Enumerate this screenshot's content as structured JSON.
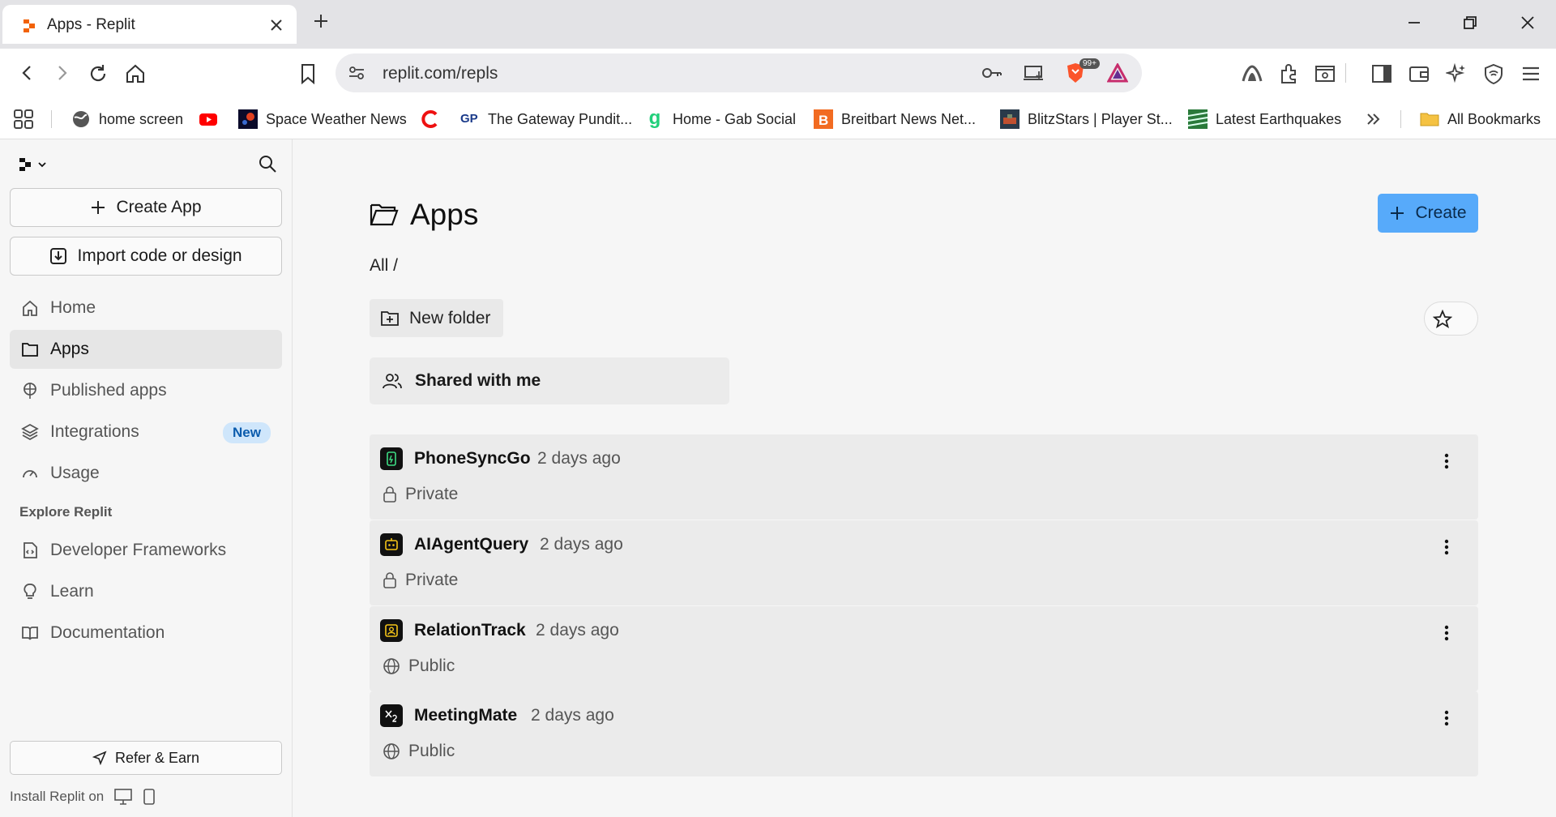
{
  "browser": {
    "tab_title": "Apps - Replit",
    "url": "replit.com/repls",
    "brave_badge": "99+",
    "bookmarks": [
      {
        "label": "home screen",
        "icon": "globe-icon"
      },
      {
        "label": "",
        "icon": "youtube-icon"
      },
      {
        "label": "Space Weather News",
        "icon": "space-weather-icon"
      },
      {
        "label": "",
        "icon": "red-c-icon"
      },
      {
        "label": "The Gateway Pundit...",
        "icon": "gp-icon"
      },
      {
        "label": "Home - Gab Social",
        "icon": "gab-icon"
      },
      {
        "label": "Breitbart News Net...",
        "icon": "breitbart-icon"
      },
      {
        "label": "BlitzStars | Player St...",
        "icon": "blitzstars-icon"
      },
      {
        "label": "Latest Earthquakes",
        "icon": "earthquake-icon"
      }
    ],
    "all_bookmarks": "All Bookmarks"
  },
  "sidebar": {
    "create_app": "Create App",
    "import": "Import code or design",
    "nav": [
      {
        "label": "Home",
        "icon": "home-icon"
      },
      {
        "label": "Apps",
        "icon": "folder-icon"
      },
      {
        "label": "Published apps",
        "icon": "published-icon"
      },
      {
        "label": "Integrations",
        "icon": "layers-icon",
        "badge": "New"
      },
      {
        "label": "Usage",
        "icon": "gauge-icon"
      }
    ],
    "explore_heading": "Explore Replit",
    "explore": [
      {
        "label": "Developer Frameworks",
        "icon": "code-file-icon"
      },
      {
        "label": "Learn",
        "icon": "lightbulb-icon"
      },
      {
        "label": "Documentation",
        "icon": "book-icon"
      }
    ],
    "refer": "Refer & Earn",
    "install": "Install Replit on"
  },
  "main": {
    "title": "Apps",
    "create_button": "Create",
    "breadcrumb": "All /",
    "new_folder": "New folder",
    "shared": "Shared with me",
    "repls": [
      {
        "name": "PhoneSyncGo",
        "time": "2 days ago",
        "visibility": "Private",
        "icon_color": "#3ddc84"
      },
      {
        "name": "AIAgentQuery",
        "time": "2 days ago",
        "visibility": "Private",
        "icon_color": "#f5c518"
      },
      {
        "name": "RelationTrack",
        "time": "2 days ago",
        "visibility": "Public",
        "icon_color": "#f5c518"
      },
      {
        "name": "MeetingMate",
        "time": "2 days ago",
        "visibility": "Public",
        "icon_color": "#ffffff"
      }
    ]
  },
  "colors": {
    "accent": "#57aafa",
    "replit_orange": "#f26207"
  }
}
